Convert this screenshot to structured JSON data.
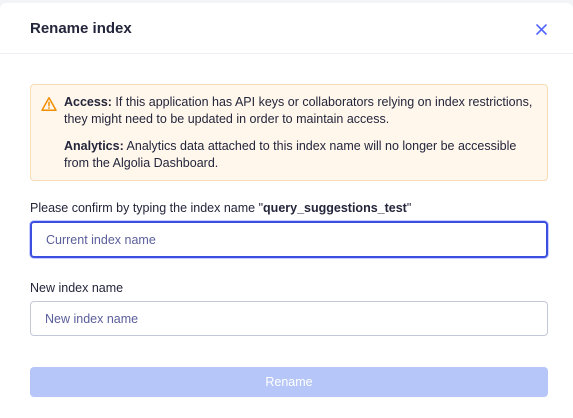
{
  "dialog": {
    "title": "Rename index",
    "close_icon": "close-icon"
  },
  "alert": {
    "icon": "warning-icon",
    "access_label": "Access:",
    "access_text": " If this application has API keys or collaborators relying on index restrictions, they might need to be updated in order to maintain access.",
    "analytics_label": "Analytics:",
    "analytics_text": " Analytics data attached to this index name will no longer be accessible from the Algolia Dashboard."
  },
  "confirm": {
    "label_prefix": "Please confirm by typing the index name \"",
    "index_name": "query_suggestions_test",
    "label_suffix": "\"",
    "placeholder": "Current index name",
    "value": ""
  },
  "new_name": {
    "label": "New index name",
    "placeholder": "New index name",
    "value": ""
  },
  "submit": {
    "label": "Rename",
    "disabled": true
  },
  "colors": {
    "accent": "#3c4fe0",
    "warning": "#f18f01",
    "alert_bg": "#fff6ec",
    "button_disabled": "#b6c6f8"
  }
}
